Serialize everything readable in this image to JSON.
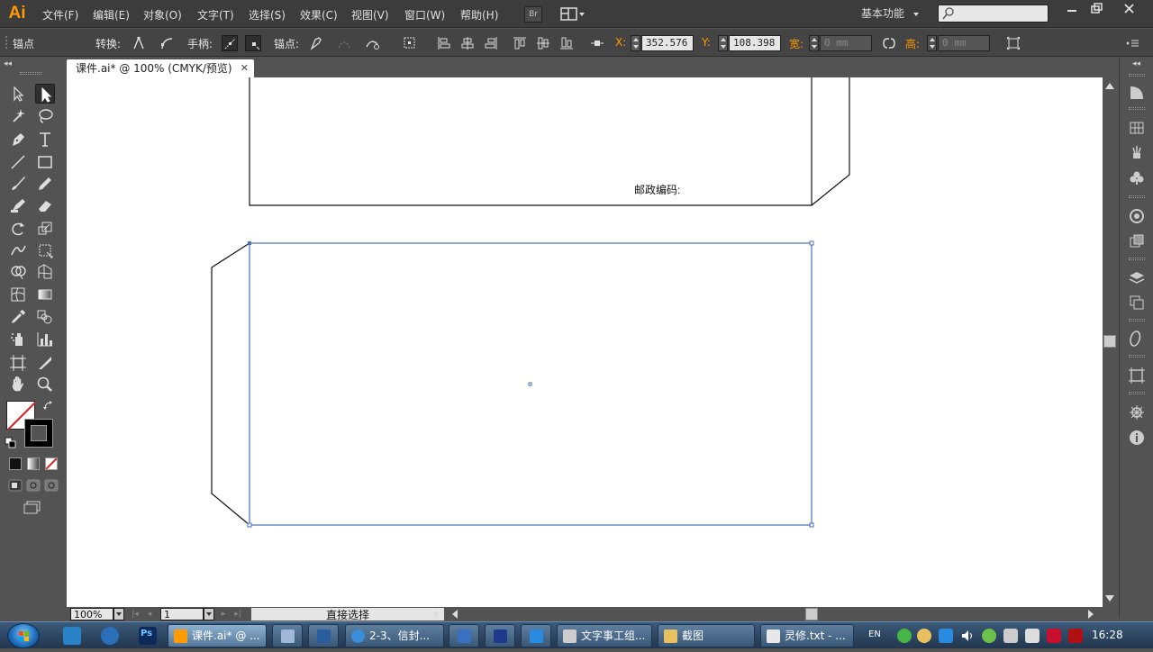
{
  "app": {
    "logo": "Ai",
    "menus": [
      "文件(F)",
      "编辑(E)",
      "对象(O)",
      "文字(T)",
      "选择(S)",
      "效果(C)",
      "视图(V)",
      "窗口(W)",
      "帮助(H)"
    ],
    "bridge_label": "Br",
    "workspace": "基本功能",
    "search_placeholder": "",
    "window_controls": [
      "minimize",
      "restore",
      "close"
    ]
  },
  "control_bar": {
    "panel_label": "锚点",
    "convert_label": "转换:",
    "handles_label": "手柄:",
    "anchors_label": "锚点:",
    "x_label": "X:",
    "x_value": "352.576 r",
    "y_label": "Y:",
    "y_value": "108.398 r",
    "w_label": "宽:",
    "w_value": "0 mm",
    "h_label": "高:",
    "h_value": "0 mm"
  },
  "document": {
    "tab_title": "课件.ai* @ 100% (CMYK/预览)",
    "postal_label": "邮政编码:",
    "accent_color": "#4a6fb5"
  },
  "status_bar": {
    "zoom": "100%",
    "page": "1",
    "current_tool": "直接选择"
  },
  "toolbox": {
    "tools": [
      "selection-tool",
      "direct-selection-tool",
      "magic-wand-tool",
      "lasso-tool",
      "pen-tool",
      "type-tool",
      "line-tool",
      "rectangle-tool",
      "paintbrush-tool",
      "pencil-tool",
      "blob-brush-tool",
      "eraser-tool",
      "rotate-tool",
      "scale-tool",
      "warp-tool",
      "free-transform-tool",
      "shape-builder-tool",
      "perspective-grid-tool",
      "mesh-tool",
      "gradient-tool",
      "eyedropper-tool",
      "blend-tool",
      "symbol-sprayer-tool",
      "column-graph-tool",
      "artboard-tool",
      "slice-tool",
      "hand-tool",
      "zoom-tool"
    ]
  },
  "taskbar": {
    "tasks": [
      {
        "label": "课件.ai* @ ...",
        "icon_color": "#ff9a00",
        "active": true
      },
      {
        "label": "",
        "icon_color": "#9fb8d8",
        "active": false
      },
      {
        "label": "",
        "icon_color": "#2a5d9e",
        "active": false
      },
      {
        "label": "2-3、信封...",
        "icon_color": "#3a8fd8",
        "active": false
      },
      {
        "label": "",
        "icon_color": "#3a70c0",
        "active": false
      },
      {
        "label": "",
        "icon_color": "#1f3a8a",
        "active": false
      },
      {
        "label": "",
        "icon_color": "#2a8ae0",
        "active": false
      },
      {
        "label": "文字事工组...",
        "icon_color": "#cccccc",
        "active": false
      },
      {
        "label": "截图",
        "icon_color": "#e8c060",
        "active": false
      },
      {
        "label": "灵修.txt - ...",
        "icon_color": "#e8e8e8",
        "active": false
      }
    ],
    "tray_lang": "EN",
    "clock": "16:28"
  }
}
